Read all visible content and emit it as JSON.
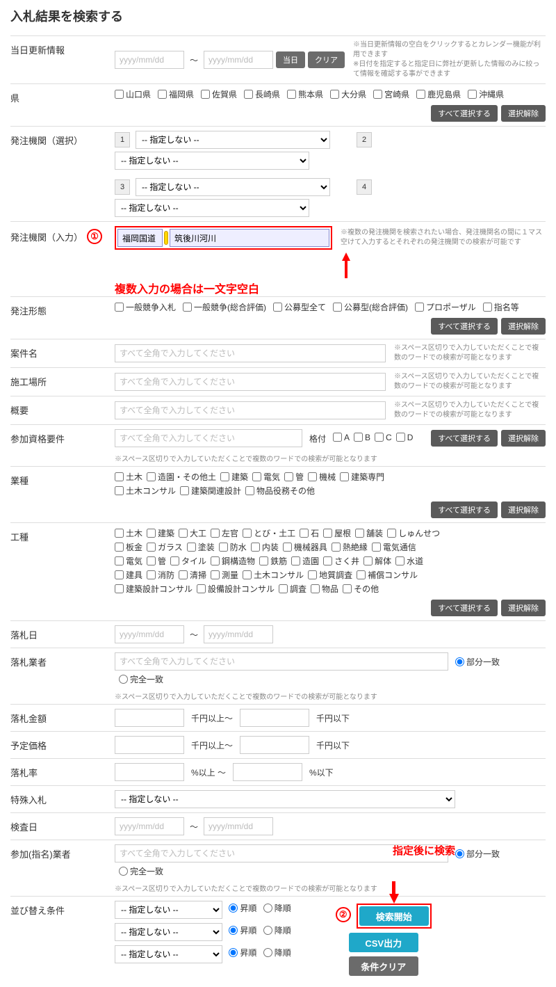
{
  "title": "入札結果を検索する",
  "rows": {
    "updateDate": {
      "label": "当日更新情報",
      "ph": "yyyy/mm/dd",
      "btnToday": "当日",
      "btnClear": "クリア",
      "note": "※当日更新情報の空白をクリックするとカレンダー機能が利用できます\n※日付を指定すると指定日に弊社が更新した情報のみに絞って情報を確認する事ができます"
    },
    "pref": {
      "label": "県",
      "items": [
        "山口県",
        "福岡県",
        "佐賀県",
        "長崎県",
        "熊本県",
        "大分県",
        "宮崎県",
        "鹿児島県",
        "沖縄県"
      ]
    },
    "orgSel": {
      "label": "発注機関（選択）",
      "opt": "-- 指定しない --"
    },
    "orgInput": {
      "label": "発注機関（入力）",
      "val1": "福岡国道",
      "val2": "筑後川河川",
      "note": "※複数の発注機関を検索されたい場合、発注機関名の間に１マス空けて入力するとそれぞれの発注機関での検索が可能です"
    },
    "orderType": {
      "label": "発注形態",
      "items": [
        "一般競争入札",
        "一般競争(総合評価)",
        "公募型全て",
        "公募型(総合評価)",
        "プロポーザル",
        "指名等"
      ]
    },
    "caseName": {
      "label": "案件名",
      "ph": "すべて全角で入力してください",
      "note": "※スペース区切りで入力していただくことで複数のワードでの検索が可能となります"
    },
    "place": {
      "label": "施工場所",
      "ph": "すべて全角で入力してください",
      "note": "※スペース区切りで入力していただくことで複数のワードでの検索が可能となります"
    },
    "summary": {
      "label": "概要",
      "ph": "すべて全角で入力してください",
      "note": "※スペース区切りで入力していただくことで複数のワードでの検索が可能となります"
    },
    "qual": {
      "label": "参加資格要件",
      "ph": "すべて全角で入力してください",
      "rank": "格付",
      "ranks": [
        "A",
        "B",
        "C",
        "D"
      ],
      "note": "※スペース区切りで入力していただくことで複数のワードでの検索が可能となります"
    },
    "industry": {
      "label": "業種",
      "items": [
        "土木",
        "造園・その他土",
        "建築",
        "電気",
        "管",
        "機械",
        "建築専門",
        "土木コンサル",
        "建築関連設計",
        "物品役務その他"
      ]
    },
    "workType": {
      "label": "工種",
      "items": [
        "土木",
        "建築",
        "大工",
        "左官",
        "とび・土工",
        "石",
        "屋根",
        "舗装",
        "しゅんせつ",
        "板金",
        "ガラス",
        "塗装",
        "防水",
        "内装",
        "機械器具",
        "熱絶縁",
        "電気通信",
        "電気",
        "管",
        "タイル",
        "鋼構造物",
        "鉄筋",
        "造園",
        "さく井",
        "解体",
        "水道",
        "建具",
        "消防",
        "清掃",
        "測量",
        "土木コンサル",
        "地質調査",
        "補償コンサル",
        "建築設計コンサル",
        "設備設計コンサル",
        "調査",
        "物品",
        "その他"
      ]
    },
    "awardDate": {
      "label": "落札日",
      "ph": "yyyy/mm/dd"
    },
    "awardee": {
      "label": "落札業者",
      "ph": "すべて全角で入力してください",
      "r1": "部分一致",
      "r2": "完全一致",
      "note": "※スペース区切りで入力していただくことで複数のワードでの検索が可能となります"
    },
    "awardAmt": {
      "label": "落札金額",
      "u1": "千円以上～",
      "u2": "千円以下"
    },
    "estPrice": {
      "label": "予定価格",
      "u1": "千円以上～",
      "u2": "千円以下"
    },
    "awardRate": {
      "label": "落札率",
      "u1": "%以上 ～",
      "u2": "%以下"
    },
    "special": {
      "label": "特殊入札",
      "opt": "-- 指定しない --"
    },
    "inspectDate": {
      "label": "検査日",
      "ph": "yyyy/mm/dd"
    },
    "nominee": {
      "label": "参加(指名)業者",
      "ph": "すべて全角で入力してください",
      "r1": "部分一致",
      "r2": "完全一致",
      "note": "※スペース区切りで入力していただくことで複数のワードでの検索が可能となります"
    },
    "sort": {
      "label": "並び替え条件",
      "opt": "-- 指定しない --",
      "asc": "昇順",
      "desc": "降順"
    }
  },
  "btns": {
    "selectAll": "すべて選択する",
    "deselect": "選択解除",
    "search": "検索開始",
    "csv": "CSV出力",
    "clear": "条件クリア"
  },
  "annot": {
    "n1": "①",
    "text1": "複数入力の場合は一文字空白",
    "n2": "②",
    "text2": "指定後に検索"
  }
}
